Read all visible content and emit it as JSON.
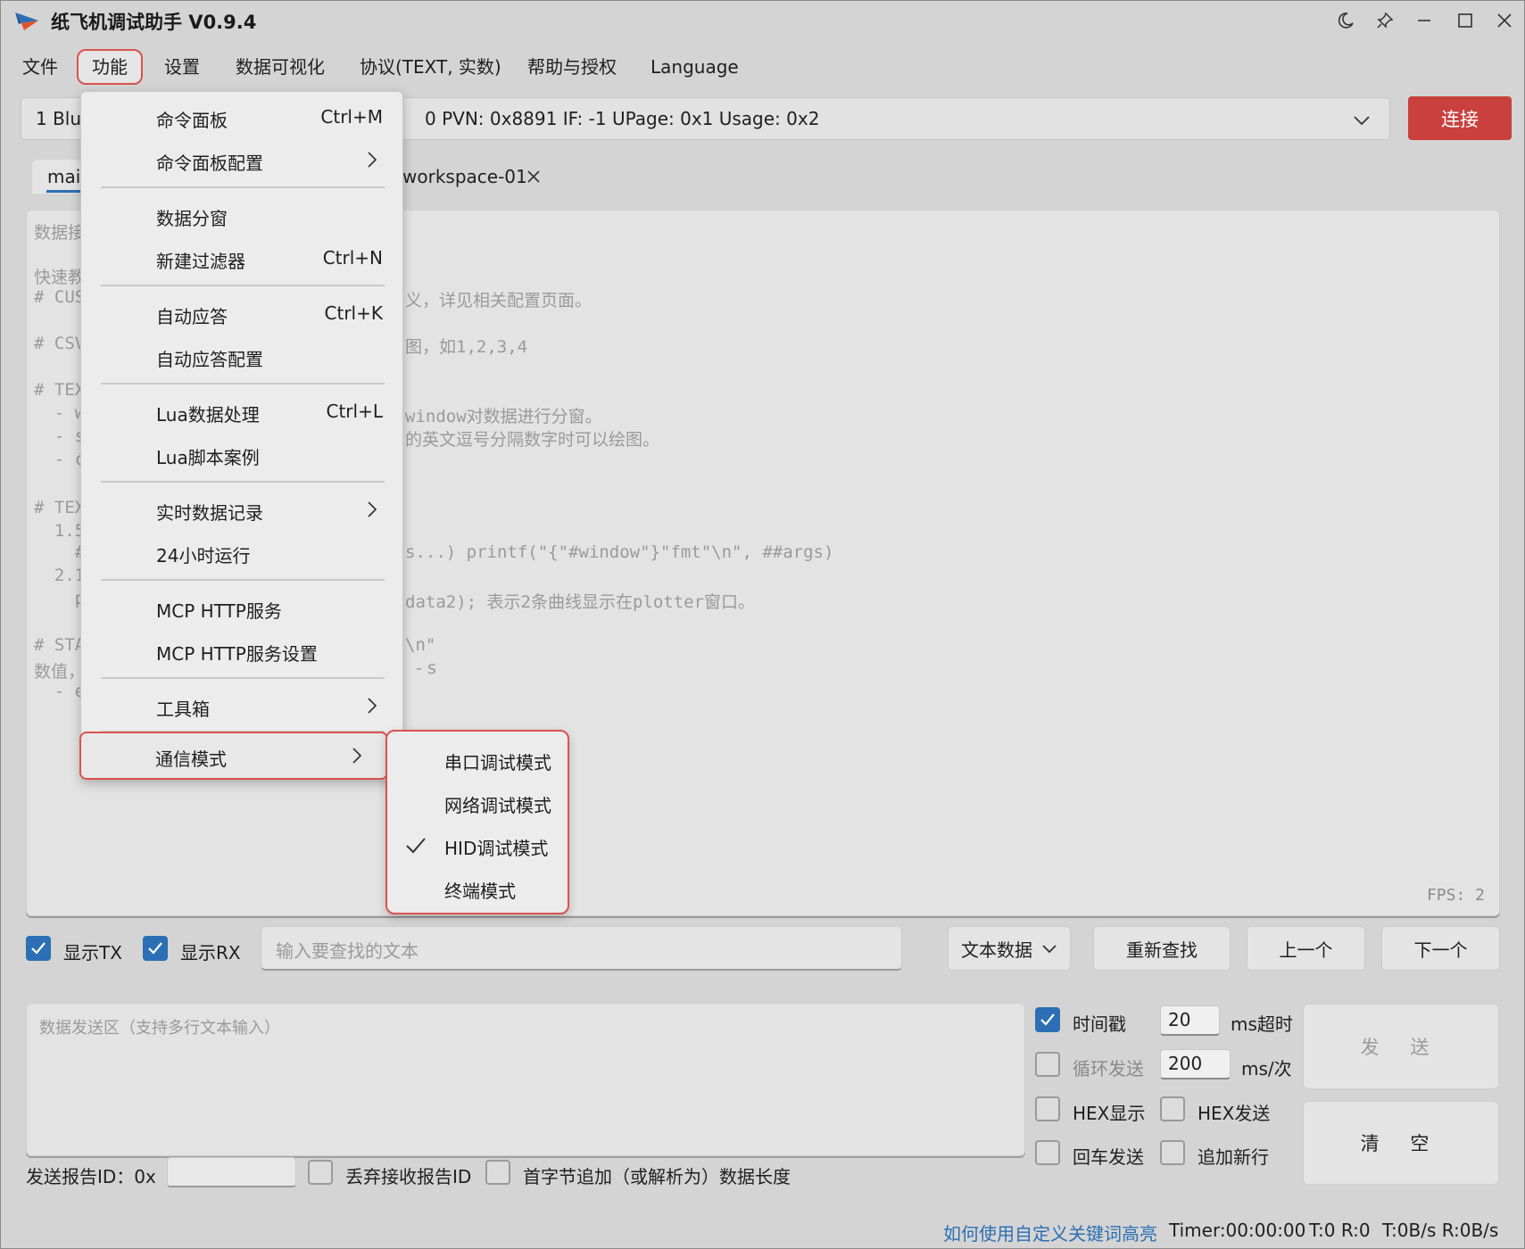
{
  "app": {
    "title": "纸飞机调试助手 V0.9.4",
    "accent": "#2c6fb4",
    "danger": "#c9403e"
  },
  "menubar": [
    "文件",
    "功能",
    "设置",
    "数据可视化",
    "协议(TEXT, 实数)",
    "帮助与授权",
    "Language"
  ],
  "device": {
    "prefix": "1 Blu",
    "text": "0 PVN: 0x8891 IF: -1 UPage: 0x1 Usage: 0x2",
    "connect_label": "连接"
  },
  "tabs": {
    "main_label": "mai",
    "workspace_label": "workspace-01"
  },
  "recv": {
    "lines": [
      "数据接",
      "快速教",
      "# CUS",
      "义，详见相关配置页面。",
      "# CSV",
      "图，如1,2,3,4",
      "# TEX",
      "window对数据进行分窗。",
      "  - w",
      "的英文逗号分隔数字时可以绘图。",
      "  - s",
      "  - c",
      "# TEX",
      "  1.5",
      "s...) printf(\"{\"#window\"}\"fmt\"\\n\", ##args)",
      "    #",
      "  2.1",
      "data2); 表示2条曲线显示在plotter窗口。",
      "    p",
      "# STA",
      "\\n\"",
      "  - s",
      "数值，将作为X轴数据源。",
      "  - e"
    ],
    "fps": "FPS: 2"
  },
  "dropdown": {
    "items": [
      {
        "label": "命令面板",
        "shortcut": "Ctrl+M"
      },
      {
        "label": "命令面板配置",
        "shortcut": ""
      },
      {
        "label": "数据分窗",
        "shortcut": ""
      },
      {
        "label": "新建过滤器",
        "shortcut": "Ctrl+N"
      },
      {
        "label": "自动应答",
        "shortcut": "Ctrl+K"
      },
      {
        "label": "自动应答配置",
        "shortcut": ""
      },
      {
        "label": "Lua数据处理",
        "shortcut": "Ctrl+L"
      },
      {
        "label": "Lua脚本案例",
        "shortcut": ""
      },
      {
        "label": "实时数据记录",
        "shortcut": ""
      },
      {
        "label": "24小时运行",
        "shortcut": ""
      },
      {
        "label": "MCP HTTP服务",
        "shortcut": ""
      },
      {
        "label": "MCP HTTP服务设置",
        "shortcut": ""
      },
      {
        "label": "工具箱",
        "shortcut": ""
      },
      {
        "label": "通信模式",
        "shortcut": ""
      }
    ]
  },
  "submenu": {
    "items": [
      "串口调试模式",
      "网络调试模式",
      "HID调试模式",
      "终端模式"
    ],
    "checked_index": 2
  },
  "search": {
    "show_tx": "显示TX",
    "show_rx": "显示RX",
    "placeholder": "输入要查找的文本",
    "mode_label": "文本数据",
    "refind": "重新查找",
    "prev": "上一个",
    "next": "下一个"
  },
  "send": {
    "placeholder": "数据发送区（支持多行文本输入）",
    "timestamp_label": "时间戳",
    "timeout_value": "20",
    "timeout_unit": "ms超时",
    "loop_label": "循环发送",
    "loop_value": "200",
    "loop_unit": "ms/次",
    "hex_show": "HEX显示",
    "hex_send": "HEX发送",
    "enter_send": "回车发送",
    "append_newline": "追加新行",
    "send_btn": "发 送",
    "clear_btn": "清 空",
    "report_id_label": "发送报告ID：0x",
    "discard_report": "丢弃接收报告ID",
    "first_byte": "首字节追加（或解析为）数据长度"
  },
  "status": {
    "link": "如何使用自定义关键词高亮",
    "timer": "Timer:00:00:00",
    "tr": "T:0 R:0",
    "rate": "T:0B/s R:0B/s"
  }
}
